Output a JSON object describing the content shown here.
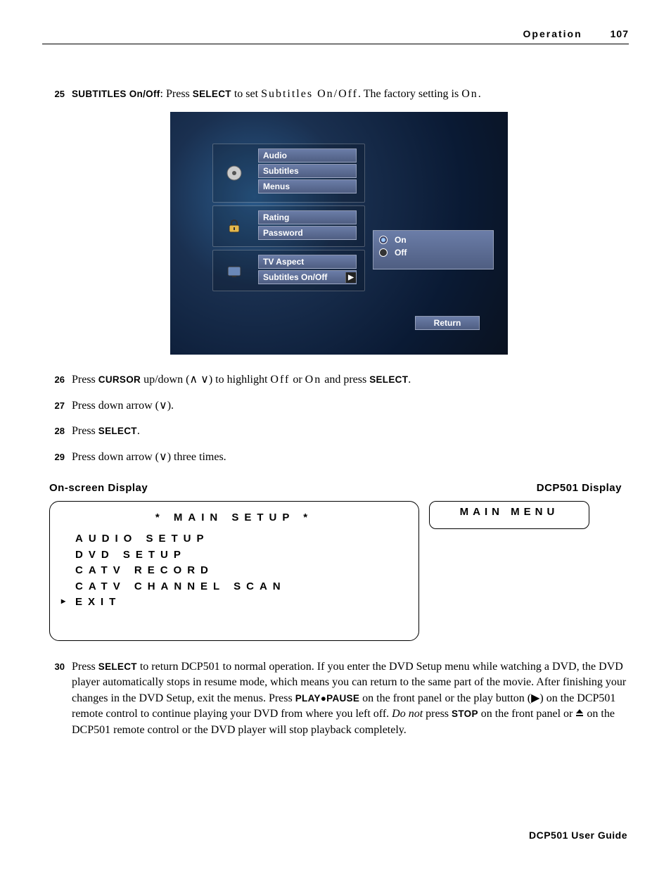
{
  "header": {
    "section": "Operation",
    "page": "107"
  },
  "step25": {
    "num": "25",
    "title": "SUBTITLES On/Off",
    "text1": ": Press ",
    "select": "SELECT",
    "text2": " to set ",
    "spaced1": "Subtitles On/Off",
    "text3": ". The factory setting is ",
    "spaced2": "On",
    "text4": "."
  },
  "dvd": {
    "menu1": [
      "Audio",
      "Subtitles",
      "Menus"
    ],
    "menu2": [
      "Rating",
      "Password"
    ],
    "menu3": [
      "TV Aspect",
      "Subtitles On/Off"
    ],
    "options": {
      "on": "On",
      "off": "Off"
    },
    "return": "Return"
  },
  "step26": {
    "num": "26",
    "t1": "Press ",
    "cursor": "CURSOR",
    "t2": " up/down (",
    "t3": ") to highlight ",
    "off": "Off",
    "t4": " or ",
    "on": "On",
    "t5": " and press ",
    "select": "SELECT",
    "t6": "."
  },
  "step27": {
    "num": "27",
    "t1": "Press down arrow (",
    "t2": ")."
  },
  "step28": {
    "num": "28",
    "t1": "Press ",
    "select": "SELECT",
    "t2": "."
  },
  "step29": {
    "num": "29",
    "t1": "Press down arrow (",
    "t2": ") three times."
  },
  "dispHeaders": {
    "left": "On-screen Display",
    "right": "DCP501 Display"
  },
  "lcd": {
    "title": "*  MAIN  SETUP  *",
    "lines": [
      "AUDIO  SETUP",
      "DVD  SETUP",
      "CATV  RECORD",
      "CATV  CHANNEL  SCAN",
      "EXIT"
    ],
    "small": "MAIN MENU"
  },
  "step30": {
    "num": "30",
    "t1": "Press ",
    "select": "SELECT",
    "t2": " to return DCP501 to normal operation. If you enter the DVD Setup menu while watching a DVD, the DVD player automatically stops in resume mode, which means you can return to the same part of the movie. After finishing your changes in the DVD Setup, exit the menus. Press ",
    "playpause": "PLAY●PAUSE",
    "t3": " on the front panel or the play button (▶) on the DCP501 remote control to continue playing your DVD from where you left off. ",
    "donot": "Do not",
    "t4": " press ",
    "stop": "STOP",
    "t5": " on the front panel or ",
    "t6": " on the DCP501 remote control or the DVD player will stop playback completely."
  },
  "footer": "DCP501 User Guide"
}
